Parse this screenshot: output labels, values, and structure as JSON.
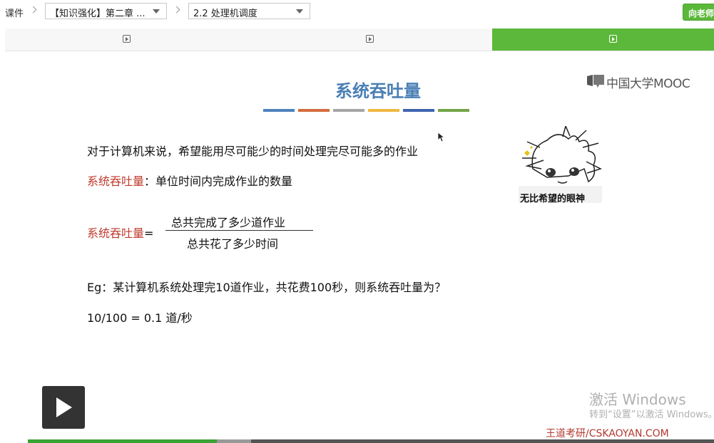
{
  "breadcrumb": {
    "root": "课件",
    "chapter_select": "【知识强化】第二章 ...",
    "section_select": "2.2 处理机调度"
  },
  "ask_button": "向老师",
  "tabs": [
    {
      "icon": "video-play-icon",
      "active": false
    },
    {
      "icon": "video-play-icon",
      "active": false
    },
    {
      "icon": "video-play-icon",
      "active": true
    }
  ],
  "slide": {
    "title": "系统吞吐量",
    "title_bar_colors": [
      "#4f81bd",
      "#d46b3c",
      "#a5a5a5",
      "#f0b840",
      "#3e64b0",
      "#72a545"
    ],
    "logo_text": "中国大学MOOC",
    "line1": "对于计算机来说，希望能用尽可能少的时间处理完尽可能多的作业",
    "def_term": "系统吞吐量",
    "def_text": "：单位时间内完成作业的数量",
    "formula_term": "系统吞吐量",
    "formula_eq": "=",
    "numerator": "总共完成了多少道作业",
    "denominator": "总共花了多少时间",
    "example": "Eg：某计算机系统处理完10道作业，共花费100秒，则系统吞吐量为？",
    "answer": "10/100 = 0.1 道/秒",
    "meme_caption": "无比希望的眼神"
  },
  "watermarks": {
    "windows_title": "激活 Windows",
    "windows_sub": "转到“设置”以激活 Windows。",
    "site": "王道考研/CSKAOYAN.COM"
  },
  "player": {
    "played_fraction": 0.275,
    "buffered_fraction": 0.325
  },
  "colors": {
    "accent_green": "#5bb83a",
    "title_blue": "#4a7fb5",
    "term_red": "#c0392b"
  }
}
